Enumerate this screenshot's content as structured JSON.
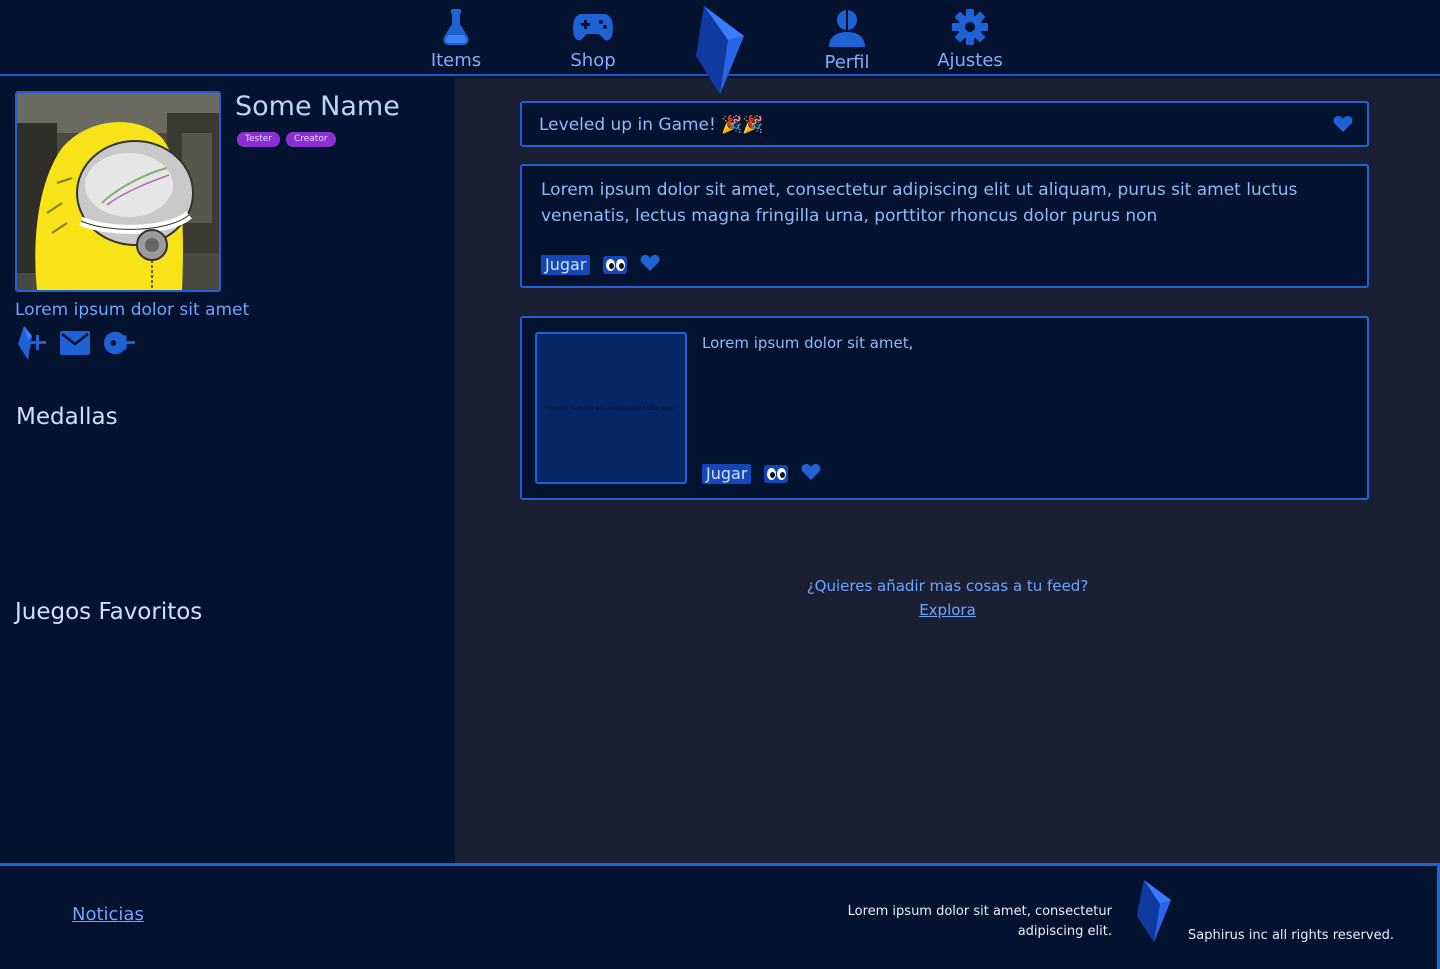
{
  "nav": {
    "items": [
      {
        "label": "Items",
        "icon": "potion-icon"
      },
      {
        "label": "Shop",
        "icon": "gamepad-icon"
      },
      {
        "label": "Perfil",
        "icon": "user-icon"
      },
      {
        "label": "Ajustes",
        "icon": "gear-icon"
      }
    ],
    "logo_icon": "crystal-logo"
  },
  "profile": {
    "name": "Some Name",
    "badges": [
      "Tester",
      "Creator"
    ],
    "bio": "Lorem ipsum dolor sit amet",
    "social_icons": [
      "crystal-add-icon",
      "mail-icon",
      "circle-add-icon"
    ],
    "avatar_icon": "hazmat-avatar"
  },
  "sections": {
    "medals": "Medallas",
    "favorites": "Juegos Favoritos"
  },
  "feed": {
    "level_up": "Leveled up in Game! 🎉🎉",
    "post1": {
      "text": "Lorem ipsum dolor sit amet, consectetur adipiscing elit ut aliquam, purus sit amet luctus venenatis, lectus magna fringilla urna, porttitor rhoncus dolor purus non",
      "play_label": "Jugar"
    },
    "post2": {
      "thumb_text": "Insorte numero del nivel al que subio aqui",
      "text": "Lorem ipsum dolor sit amet,",
      "play_label": "Jugar"
    },
    "more_question": "¿Quieres añadir mas cosas a tu feed?",
    "explore_link": "Explora"
  },
  "footer": {
    "news_link": "Noticias",
    "description": "Lorem ipsum dolor sit amet, consectetur adipiscing elit.",
    "copyright": "Saphirus inc all rights reserved."
  },
  "colors": {
    "background": "#03122f",
    "main_bg": "#1a1f33",
    "accent": "#1f62d6",
    "badge": "#8b2fd0"
  }
}
